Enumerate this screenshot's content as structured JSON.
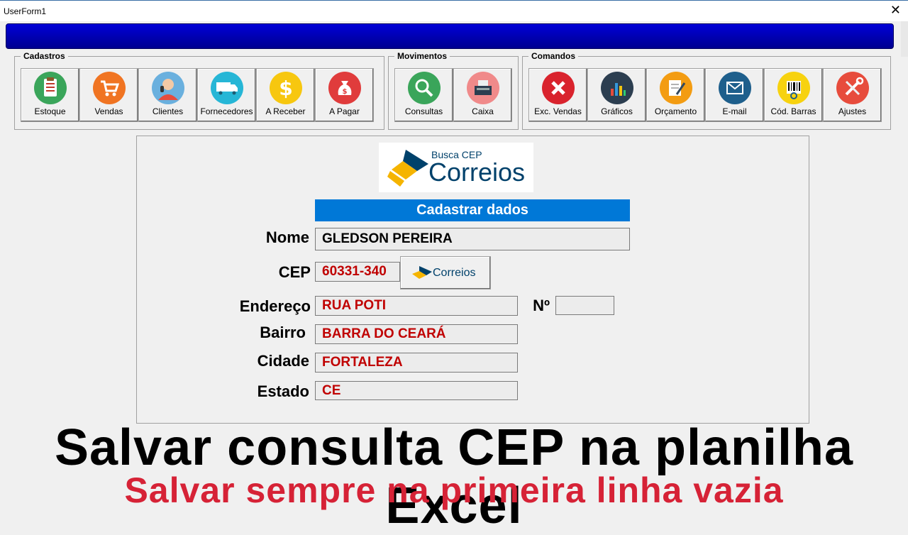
{
  "window": {
    "title": "UserForm1",
    "close": "✕"
  },
  "groups": {
    "cadastros": {
      "title": "Cadastros",
      "buttons": [
        {
          "label": "Estoque",
          "icon": "clipboard-icon"
        },
        {
          "label": "Vendas",
          "icon": "shopping-cart-icon"
        },
        {
          "label": "Clientes",
          "icon": "person-icon"
        },
        {
          "label": "Fornecedores",
          "icon": "delivery-truck-icon"
        },
        {
          "label": "A Receber",
          "icon": "dollar-icon"
        },
        {
          "label": "A Pagar",
          "icon": "money-bag-icon"
        }
      ]
    },
    "movimentos": {
      "title": "Movimentos",
      "buttons": [
        {
          "label": "Consultas",
          "icon": "magnifier-icon"
        },
        {
          "label": "Caixa",
          "icon": "cash-register-icon"
        }
      ]
    },
    "comandos": {
      "title": "Comandos",
      "buttons": [
        {
          "label": "Exc. Vendas",
          "icon": "delete-x-icon"
        },
        {
          "label": "Gráficos",
          "icon": "bar-chart-icon"
        },
        {
          "label": "Orçamento",
          "icon": "notepad-pencil-icon"
        },
        {
          "label": "E-mail",
          "icon": "envelope-icon"
        },
        {
          "label": "Cód. Barras",
          "icon": "barcode-icon"
        },
        {
          "label": "Ajustes",
          "icon": "wrench-tools-icon"
        }
      ]
    }
  },
  "logo": {
    "line1": "Busca CEP",
    "line2": "Correios"
  },
  "form": {
    "header": "Cadastrar dados",
    "nome": {
      "label": "Nome",
      "value": "GLEDSON PEREIRA"
    },
    "cep": {
      "label": "CEP",
      "value": "60331-340",
      "button_label": "Correios"
    },
    "endereco": {
      "label": "Endereço",
      "value": "RUA POTI"
    },
    "numero": {
      "label": "Nº",
      "value": ""
    },
    "bairro": {
      "label": "Bairro",
      "value": "BARRA DO CEARÁ"
    },
    "cidade": {
      "label": "Cidade",
      "value": "FORTALEZA"
    },
    "estado": {
      "label": "Estado",
      "value": "CE"
    }
  },
  "caption": {
    "line1": "Salvar consulta CEP na planilha Excel",
    "line2": "Salvar sempre na primeira linha vazia"
  },
  "colors": {
    "accent_blue": "#0078d7",
    "value_red": "#c00000",
    "caption_red": "#d62236",
    "brand_blue": "#00416b",
    "brand_yellow": "#f5b400"
  }
}
